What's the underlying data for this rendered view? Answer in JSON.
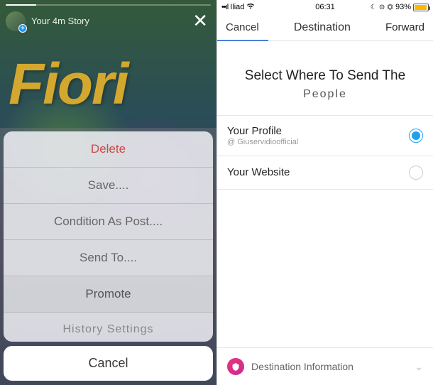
{
  "left": {
    "storyLabel": "Your 4m Story",
    "bigText": "Fiori",
    "menu": {
      "delete": "Delete",
      "save": "Save....",
      "conditionAsPost": "Condition As Post....",
      "sendTo": "Send To....",
      "promote": "Promote",
      "historySettings": "History Settings"
    },
    "cancel": "Cancel"
  },
  "right": {
    "status": {
      "carrier": "Iliad",
      "time": "06:31",
      "batteryPct": "93%"
    },
    "nav": {
      "cancel": "Cancel",
      "title": "Destination",
      "forward": "Forward"
    },
    "heading": {
      "line1": "Select Where To Send The",
      "line2": "People"
    },
    "options": {
      "profile": {
        "title": "Your Profile",
        "subtitle": "@ Giuservidioofficial"
      },
      "website": {
        "title": "Your Website"
      }
    },
    "footer": {
      "label": "Destination Information"
    }
  }
}
